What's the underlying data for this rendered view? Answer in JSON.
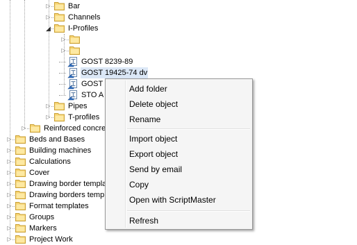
{
  "tree": {
    "nodes": [
      {
        "label": "Bar",
        "expander": "collapsed",
        "icon": "folder-icon"
      },
      {
        "label": "Channels",
        "expander": "collapsed",
        "icon": "folder-icon"
      },
      {
        "label": "I-Profiles",
        "expander": "expanded",
        "icon": "folder-open-icon"
      },
      {
        "label": "",
        "expander": "collapsed",
        "icon": "folder-icon"
      },
      {
        "label": "",
        "expander": "collapsed",
        "icon": "folder-icon"
      },
      {
        "label": "GOST 8239-89",
        "expander": "none",
        "icon": "profile-catalog-icon"
      },
      {
        "label": "GOST 19425-74 dv",
        "expander": "none",
        "icon": "profile-catalog-icon",
        "selected": true
      },
      {
        "label": "GOST",
        "expander": "none",
        "icon": "profile-catalog-icon"
      },
      {
        "label": "STO A",
        "expander": "none",
        "icon": "profile-catalog-icon"
      },
      {
        "label": "Pipes",
        "expander": "collapsed",
        "icon": "folder-icon"
      },
      {
        "label": "T-profiles",
        "expander": "collapsed",
        "icon": "folder-icon"
      },
      {
        "label": "Reinforced concrete",
        "expander": "collapsed",
        "icon": "folder-icon"
      },
      {
        "label": "Beds and Bases",
        "expander": "collapsed",
        "icon": "folder-icon"
      },
      {
        "label": "Building machines",
        "expander": "collapsed",
        "icon": "folder-icon"
      },
      {
        "label": "Calculations",
        "expander": "collapsed",
        "icon": "folder-icon"
      },
      {
        "label": "Cover",
        "expander": "collapsed",
        "icon": "folder-icon"
      },
      {
        "label": "Drawing border templates",
        "expander": "collapsed",
        "icon": "folder-icon"
      },
      {
        "label": "Drawing borders templates",
        "expander": "collapsed",
        "icon": "folder-icon"
      },
      {
        "label": "Format templates",
        "expander": "collapsed",
        "icon": "folder-icon"
      },
      {
        "label": "Groups",
        "expander": "collapsed",
        "icon": "folder-icon"
      },
      {
        "label": "Markers",
        "expander": "collapsed",
        "icon": "folder-icon"
      },
      {
        "label": "Project Work",
        "expander": "collapsed",
        "icon": "folder-icon"
      }
    ]
  },
  "context_menu": {
    "items": [
      {
        "label": "Add folder"
      },
      {
        "label": "Delete object"
      },
      {
        "label": "Rename"
      },
      {
        "separator": true
      },
      {
        "label": "Import object"
      },
      {
        "label": "Export object"
      },
      {
        "label": "Send by email"
      },
      {
        "label": "Copy"
      },
      {
        "label": "Open with ScriptMaster"
      },
      {
        "separator": true
      },
      {
        "label": "Refresh"
      }
    ]
  }
}
